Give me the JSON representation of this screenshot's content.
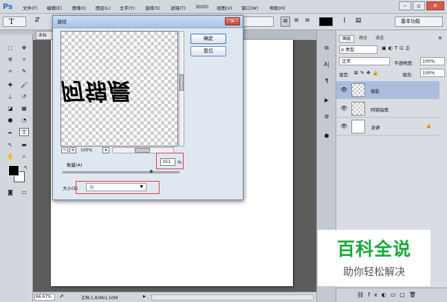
{
  "app": {
    "logo": "Ps"
  },
  "menu": [
    {
      "key": "file",
      "label": "文件(F)"
    },
    {
      "key": "edit",
      "label": "编辑(E)"
    },
    {
      "key": "image",
      "label": "图像(I)"
    },
    {
      "key": "layer",
      "label": "图层(L)"
    },
    {
      "key": "type",
      "label": "文字(Y)"
    },
    {
      "key": "select",
      "label": "选择(S)"
    },
    {
      "key": "filter",
      "label": "滤镜(T)"
    },
    {
      "key": "3d",
      "label": "3D(D)"
    },
    {
      "key": "view",
      "label": "视图(V)"
    },
    {
      "key": "window",
      "label": "窗口(W)"
    },
    {
      "key": "help",
      "label": "帮助(H)"
    }
  ],
  "window_controls": {
    "minimize": "–",
    "restore": "▫",
    "close": "✕"
  },
  "options_bar": {
    "tool_glyph": "T",
    "workspace": "基本功能"
  },
  "document": {
    "tab_title": "未标",
    "zoom": "66.67%",
    "doc_info": "文档:1.83M/1.50M"
  },
  "dialog": {
    "title": "波纹",
    "ok": "确定",
    "reset": "复位",
    "preview_zoom": "100%",
    "preview_text": "阿锦晨",
    "amount_label": "数量(A)",
    "amount_value": "351",
    "amount_unit": "%",
    "amount_fraction": 0.76,
    "size_label": "大小(S)",
    "size_value": "小"
  },
  "layers_panel": {
    "tabs": [
      "图层",
      "路径",
      "通道"
    ],
    "filter": "ρ 类型",
    "blend_mode": "正常",
    "opacity_label": "不透明度:",
    "opacity_value": "100%",
    "lock_label": "锁定:",
    "fill_label": "填充:",
    "fill_value": "100%",
    "layers": [
      {
        "name": "倒影",
        "selected": true
      },
      {
        "name": "阿锦指南",
        "selected": false
      },
      {
        "name": "背景",
        "selected": false
      }
    ]
  },
  "watermark": {
    "title": "百科全说",
    "subtitle": "助你轻松解决"
  },
  "colors": {
    "accent": "#2a6fc4",
    "selection": "#a9bedf",
    "watermark_green": "#19a83a",
    "highlight": "#e23a3a"
  }
}
